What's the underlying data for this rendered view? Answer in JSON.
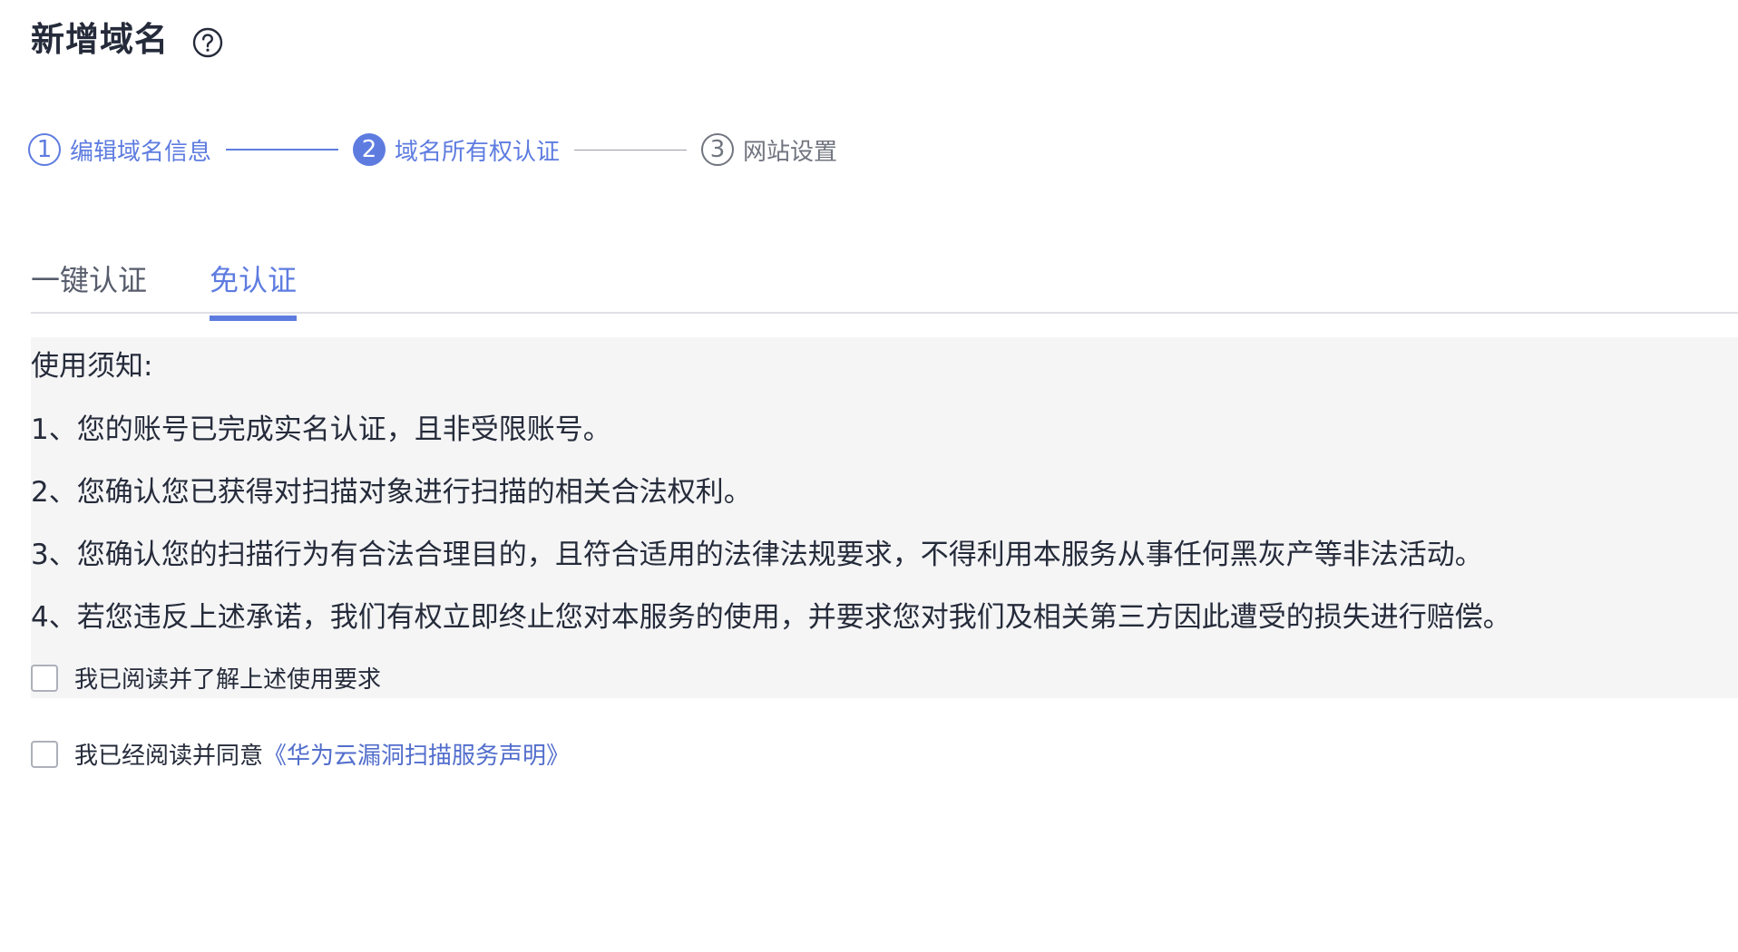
{
  "header": {
    "title": "新增域名",
    "help_icon": "question-circle-icon"
  },
  "steps": [
    {
      "number": "1",
      "label": "编辑域名信息",
      "state": "done"
    },
    {
      "number": "2",
      "label": "域名所有权认证",
      "state": "active"
    },
    {
      "number": "3",
      "label": "网站设置",
      "state": "todo"
    }
  ],
  "tabs": [
    {
      "label": "一键认证",
      "selected": false
    },
    {
      "label": "免认证",
      "selected": true
    }
  ],
  "notice": {
    "title": "使用须知:",
    "items": [
      "1、您的账号已完成实名认证，且非受限账号。",
      "2、您确认您已获得对扫描对象进行扫描的相关合法权利。",
      "3、您确认您的扫描行为有合法合理目的，且符合适用的法律法规要求，不得利用本服务从事任何黑灰产等非法活动。",
      "4、若您违反上述承诺，我们有权立即终止您对本服务的使用，并要求您对我们及相关第三方因此遭受的损失进行赔偿。"
    ],
    "checkbox_label": "我已阅读并了解上述使用要求",
    "checked": false
  },
  "agreement": {
    "prefix": "我已经阅读并同意",
    "link_text": "《华为云漏洞扫描服务声明》",
    "checked": false
  },
  "colors": {
    "accent": "#5e7ce0",
    "link": "#526ecc",
    "text": "#252b3a",
    "muted": "#71757f",
    "panel_bg": "#f5f5f6"
  }
}
